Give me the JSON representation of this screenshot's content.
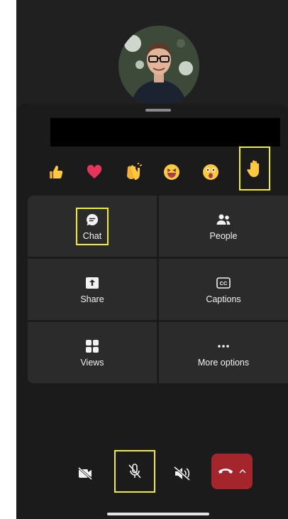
{
  "reactions": [
    {
      "name": "like",
      "icon": "thumbs-up-icon"
    },
    {
      "name": "heart",
      "icon": "heart-icon"
    },
    {
      "name": "applause",
      "icon": "clapping-hands-icon"
    },
    {
      "name": "laugh",
      "icon": "laughing-face-icon"
    },
    {
      "name": "surprised",
      "icon": "surprised-face-icon"
    },
    {
      "name": "raise-hand",
      "icon": "raised-hand-icon"
    }
  ],
  "menu": {
    "chat": {
      "label": "Chat",
      "icon": "chat-bubble-icon"
    },
    "people": {
      "label": "People",
      "icon": "people-icon"
    },
    "share": {
      "label": "Share",
      "icon": "share-icon"
    },
    "captions": {
      "label": "Captions",
      "icon": "cc-icon"
    },
    "views": {
      "label": "Views",
      "icon": "grid-icon"
    },
    "more": {
      "label": "More options",
      "icon": "ellipsis-icon"
    }
  },
  "controls": {
    "camera": {
      "icon": "camera-off-icon"
    },
    "mic": {
      "icon": "mic-off-icon"
    },
    "speaker": {
      "icon": "speaker-off-icon"
    },
    "hangup": {
      "icon": "hang-up-icon",
      "color": "#a4262c"
    }
  },
  "colors": {
    "highlight": "#f5ee1f",
    "tile": "#2b2b2b",
    "sheet": "#1b1b1b"
  }
}
